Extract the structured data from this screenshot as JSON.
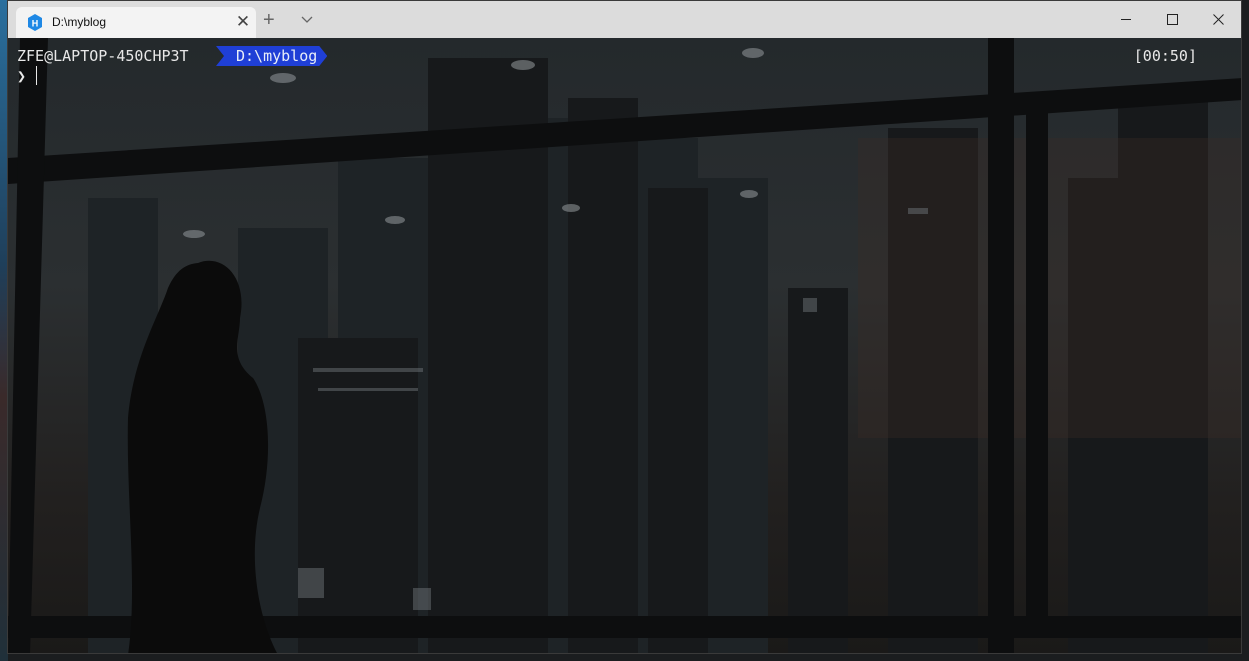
{
  "tab": {
    "title": "D:\\myblog",
    "icon": "terminal-app-icon",
    "close_glyph": "✕",
    "new_tab_glyph": "+"
  },
  "terminal": {
    "user_host": "ZFE@LAPTOP-450CHP3T",
    "path": "D:\\myblog",
    "time": "[00:50]",
    "prompt_symbol": "❯"
  },
  "colors": {
    "path_segment": "#1f3fd6",
    "titlebar": "#dcdcdc",
    "tab_active": "#f3f3f3",
    "text": "#e8e8e8"
  }
}
